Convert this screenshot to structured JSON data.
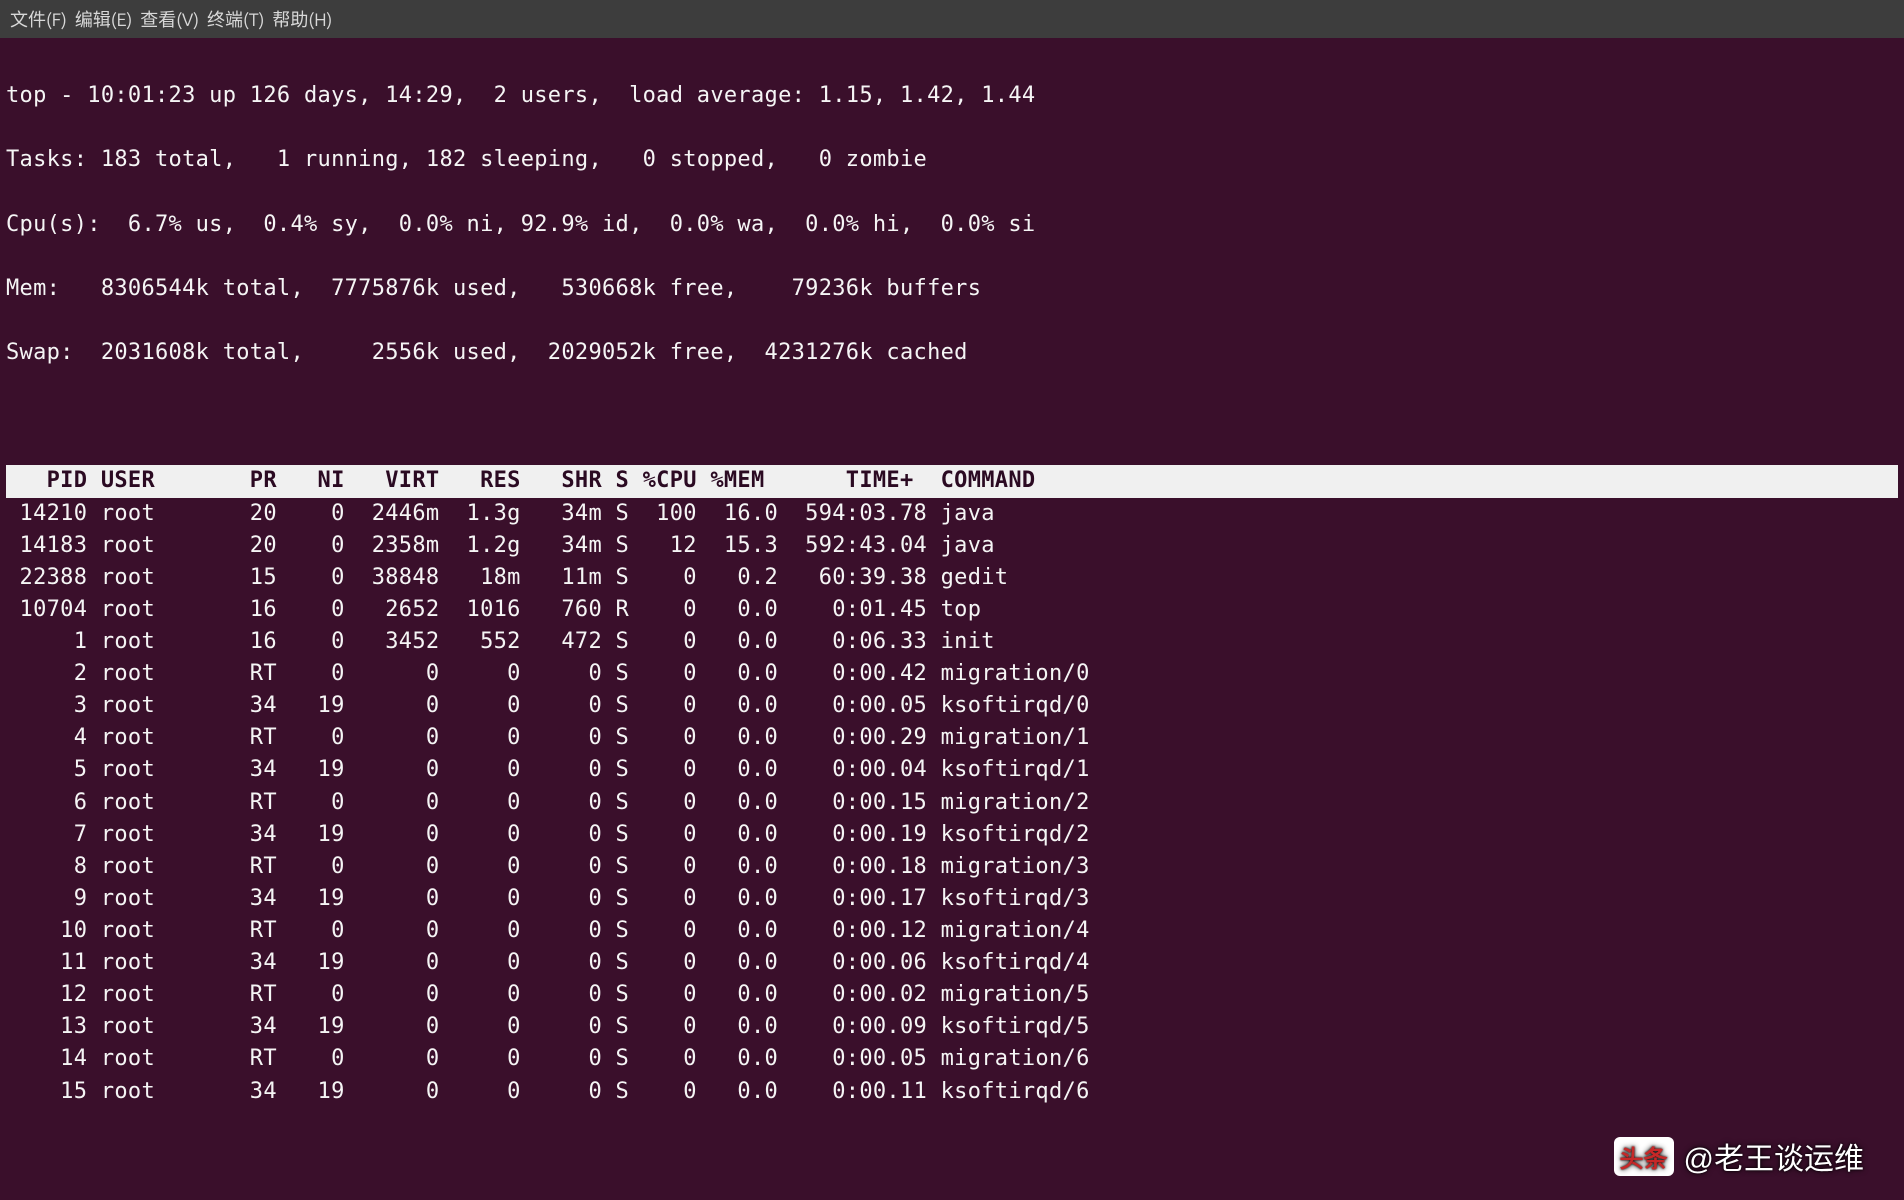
{
  "menubar": {
    "file": "文件(F)",
    "edit": "编辑(E)",
    "view": "查看(V)",
    "terminal": "终端(T)",
    "help": "帮助(H)"
  },
  "summary": {
    "line1": "top - 10:01:23 up 126 days, 14:29,  2 users,  load average: 1.15, 1.42, 1.44",
    "line2": "Tasks: 183 total,   1 running, 182 sleeping,   0 stopped,   0 zombie",
    "line3": "Cpu(s):  6.7% us,  0.4% sy,  0.0% ni, 92.9% id,  0.0% wa,  0.0% hi,  0.0% si",
    "line4": "Mem:   8306544k total,  7775876k used,   530668k free,    79236k buffers",
    "line5": "Swap:  2031608k total,     2556k used,  2029052k free,  4231276k cached"
  },
  "columns": [
    "PID",
    "USER",
    "PR",
    "NI",
    "VIRT",
    "RES",
    "SHR",
    "S",
    "%CPU",
    "%MEM",
    "TIME+",
    "COMMAND"
  ],
  "processes": [
    {
      "pid": "14210",
      "user": "root",
      "pr": "20",
      "ni": "0",
      "virt": "2446m",
      "res": "1.3g",
      "shr": "34m",
      "s": "S",
      "cpu": "100",
      "mem": "16.0",
      "time": "594:03.78",
      "command": "java"
    },
    {
      "pid": "14183",
      "user": "root",
      "pr": "20",
      "ni": "0",
      "virt": "2358m",
      "res": "1.2g",
      "shr": "34m",
      "s": "S",
      "cpu": "12",
      "mem": "15.3",
      "time": "592:43.04",
      "command": "java"
    },
    {
      "pid": "22388",
      "user": "root",
      "pr": "15",
      "ni": "0",
      "virt": "38848",
      "res": "18m",
      "shr": "11m",
      "s": "S",
      "cpu": "0",
      "mem": "0.2",
      "time": "60:39.38",
      "command": "gedit"
    },
    {
      "pid": "10704",
      "user": "root",
      "pr": "16",
      "ni": "0",
      "virt": "2652",
      "res": "1016",
      "shr": "760",
      "s": "R",
      "cpu": "0",
      "mem": "0.0",
      "time": "0:01.45",
      "command": "top"
    },
    {
      "pid": "1",
      "user": "root",
      "pr": "16",
      "ni": "0",
      "virt": "3452",
      "res": "552",
      "shr": "472",
      "s": "S",
      "cpu": "0",
      "mem": "0.0",
      "time": "0:06.33",
      "command": "init"
    },
    {
      "pid": "2",
      "user": "root",
      "pr": "RT",
      "ni": "0",
      "virt": "0",
      "res": "0",
      "shr": "0",
      "s": "S",
      "cpu": "0",
      "mem": "0.0",
      "time": "0:00.42",
      "command": "migration/0"
    },
    {
      "pid": "3",
      "user": "root",
      "pr": "34",
      "ni": "19",
      "virt": "0",
      "res": "0",
      "shr": "0",
      "s": "S",
      "cpu": "0",
      "mem": "0.0",
      "time": "0:00.05",
      "command": "ksoftirqd/0"
    },
    {
      "pid": "4",
      "user": "root",
      "pr": "RT",
      "ni": "0",
      "virt": "0",
      "res": "0",
      "shr": "0",
      "s": "S",
      "cpu": "0",
      "mem": "0.0",
      "time": "0:00.29",
      "command": "migration/1"
    },
    {
      "pid": "5",
      "user": "root",
      "pr": "34",
      "ni": "19",
      "virt": "0",
      "res": "0",
      "shr": "0",
      "s": "S",
      "cpu": "0",
      "mem": "0.0",
      "time": "0:00.04",
      "command": "ksoftirqd/1"
    },
    {
      "pid": "6",
      "user": "root",
      "pr": "RT",
      "ni": "0",
      "virt": "0",
      "res": "0",
      "shr": "0",
      "s": "S",
      "cpu": "0",
      "mem": "0.0",
      "time": "0:00.15",
      "command": "migration/2"
    },
    {
      "pid": "7",
      "user": "root",
      "pr": "34",
      "ni": "19",
      "virt": "0",
      "res": "0",
      "shr": "0",
      "s": "S",
      "cpu": "0",
      "mem": "0.0",
      "time": "0:00.19",
      "command": "ksoftirqd/2"
    },
    {
      "pid": "8",
      "user": "root",
      "pr": "RT",
      "ni": "0",
      "virt": "0",
      "res": "0",
      "shr": "0",
      "s": "S",
      "cpu": "0",
      "mem": "0.0",
      "time": "0:00.18",
      "command": "migration/3"
    },
    {
      "pid": "9",
      "user": "root",
      "pr": "34",
      "ni": "19",
      "virt": "0",
      "res": "0",
      "shr": "0",
      "s": "S",
      "cpu": "0",
      "mem": "0.0",
      "time": "0:00.17",
      "command": "ksoftirqd/3"
    },
    {
      "pid": "10",
      "user": "root",
      "pr": "RT",
      "ni": "0",
      "virt": "0",
      "res": "0",
      "shr": "0",
      "s": "S",
      "cpu": "0",
      "mem": "0.0",
      "time": "0:00.12",
      "command": "migration/4"
    },
    {
      "pid": "11",
      "user": "root",
      "pr": "34",
      "ni": "19",
      "virt": "0",
      "res": "0",
      "shr": "0",
      "s": "S",
      "cpu": "0",
      "mem": "0.0",
      "time": "0:00.06",
      "command": "ksoftirqd/4"
    },
    {
      "pid": "12",
      "user": "root",
      "pr": "RT",
      "ni": "0",
      "virt": "0",
      "res": "0",
      "shr": "0",
      "s": "S",
      "cpu": "0",
      "mem": "0.0",
      "time": "0:00.02",
      "command": "migration/5"
    },
    {
      "pid": "13",
      "user": "root",
      "pr": "34",
      "ni": "19",
      "virt": "0",
      "res": "0",
      "shr": "0",
      "s": "S",
      "cpu": "0",
      "mem": "0.0",
      "time": "0:00.09",
      "command": "ksoftirqd/5"
    },
    {
      "pid": "14",
      "user": "root",
      "pr": "RT",
      "ni": "0",
      "virt": "0",
      "res": "0",
      "shr": "0",
      "s": "S",
      "cpu": "0",
      "mem": "0.0",
      "time": "0:00.05",
      "command": "migration/6"
    },
    {
      "pid": "15",
      "user": "root",
      "pr": "34",
      "ni": "19",
      "virt": "0",
      "res": "0",
      "shr": "0",
      "s": "S",
      "cpu": "0",
      "mem": "0.0",
      "time": "0:00.11",
      "command": "ksoftirqd/6"
    }
  ],
  "watermark": {
    "logo": "头条",
    "text": "@老王谈运维"
  }
}
